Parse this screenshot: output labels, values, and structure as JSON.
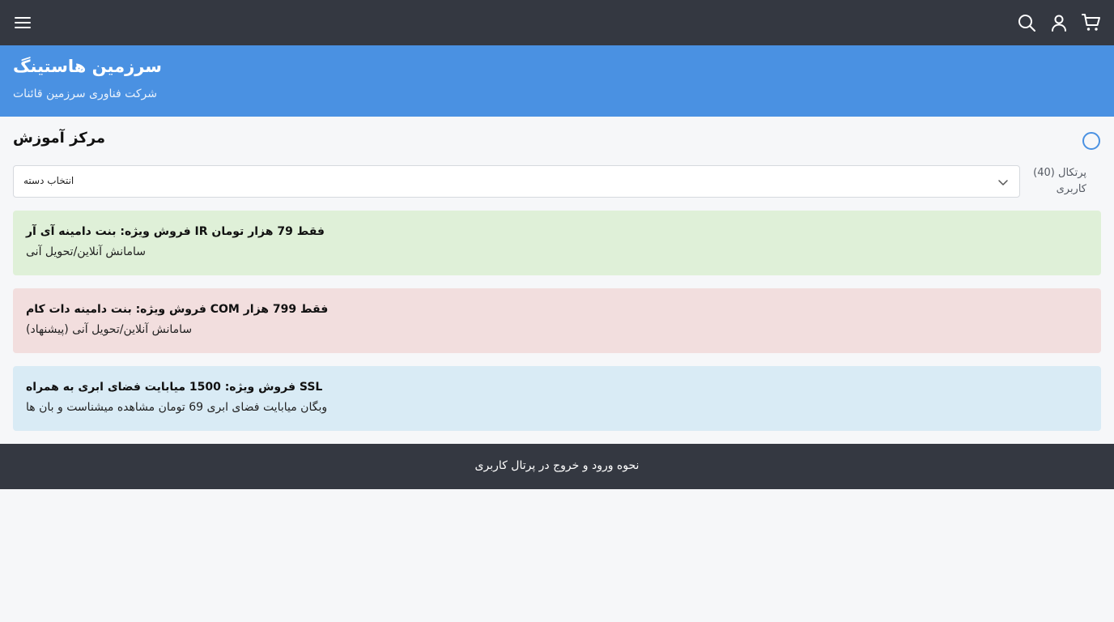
{
  "topbar": {
    "icons": [
      "menu-icon",
      "search-icon",
      "user-icon",
      "cart-icon"
    ],
    "background": "#343841"
  },
  "brand": {
    "title": "سرزمین هاستینگ",
    "subtitle": "شرکت فناوری سرزمین قائنات",
    "color": "#4a91e2"
  },
  "main": {
    "title": "مرکز آموزش",
    "portal_label": "پرتکال",
    "portal_count": "(40)",
    "portal_label_line2": "کاربری",
    "category_select": {
      "selected": "انتخاب دسته"
    }
  },
  "cards": [
    {
      "title": "فقط 79 هزار تومان IR فروش ویژه: بنت دامینه آی آر",
      "subtitle": "سامانش آنلاین/تحویل آنی",
      "color": "#dff0d8"
    },
    {
      "title": "فقط 799 هزار COM فروش ویژه: بنت دامینه دات کام",
      "subtitle": "سامانش آنلاین/تحویل آنی (پیشنهاد)",
      "color": "#f2dede"
    },
    {
      "title": "SSL فروش ویژه: 1500 میابایت فضای ابری به همراه",
      "subtitle": "وبگان میابایت فضای ابری 69 تومان مشاهده میشناست و بان ها",
      "color": "#d9ebf5"
    }
  ],
  "footer": {
    "link": "نحوه ورود و خروج در پرتال کاربری"
  }
}
